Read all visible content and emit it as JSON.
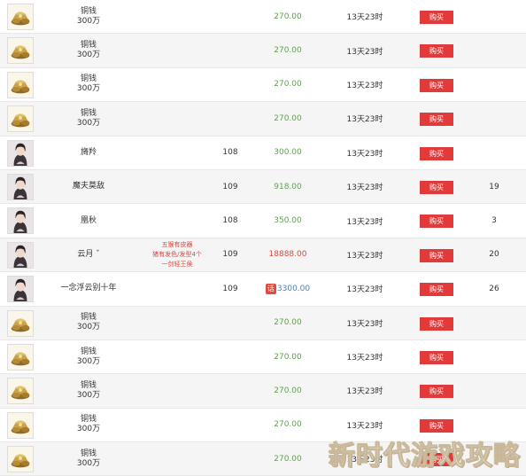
{
  "listings": [
    {
      "kind": "coin",
      "name1": "铜钱",
      "name2": "300万",
      "level": "",
      "price": "270.00",
      "price_style": "green",
      "time": "13天23时",
      "buy": "购买",
      "count": ""
    },
    {
      "kind": "coin",
      "name1": "铜钱",
      "name2": "300万",
      "level": "",
      "price": "270.00",
      "price_style": "green",
      "time": "13天23时",
      "buy": "购买",
      "count": ""
    },
    {
      "kind": "coin",
      "name1": "铜钱",
      "name2": "300万",
      "level": "",
      "price": "270.00",
      "price_style": "green",
      "time": "13天23时",
      "buy": "购买",
      "count": ""
    },
    {
      "kind": "coin",
      "name1": "铜钱",
      "name2": "300万",
      "level": "",
      "price": "270.00",
      "price_style": "green",
      "time": "13天23时",
      "buy": "购买",
      "count": ""
    },
    {
      "kind": "char",
      "name1": "旖羚",
      "name2": "",
      "level": "108",
      "price": "300.00",
      "price_style": "green",
      "time": "13天23时",
      "buy": "购买",
      "count": ""
    },
    {
      "kind": "char",
      "name1": "魔夫莫敌",
      "name2": "",
      "level": "109",
      "price": "918.00",
      "price_style": "green",
      "time": "13天23时",
      "buy": "购买",
      "count": "19"
    },
    {
      "kind": "char",
      "name1": "凰秋",
      "name2": "",
      "level": "108",
      "price": "350.00",
      "price_style": "green",
      "time": "13天23时",
      "buy": "购买",
      "count": "3"
    },
    {
      "kind": "char",
      "name1": "云月 ˇ",
      "name2": "",
      "level": "109",
      "price": "18888.00",
      "price_style": "red",
      "time": "13天23时",
      "buy": "购买",
      "count": "20",
      "desc": [
        "五猴有皮器",
        "猪有发色/发型4个",
        "一剑轻王侯"
      ]
    },
    {
      "kind": "char",
      "name1": "一念浮云别十年",
      "name2": "",
      "level": "109",
      "price": "3300.00",
      "price_style": "blue",
      "price_tag": "话",
      "time": "13天23时",
      "buy": "购买",
      "count": "26"
    },
    {
      "kind": "coin",
      "name1": "铜钱",
      "name2": "300万",
      "level": "",
      "price": "270.00",
      "price_style": "green",
      "time": "13天23时",
      "buy": "购买",
      "count": ""
    },
    {
      "kind": "coin",
      "name1": "铜钱",
      "name2": "300万",
      "level": "",
      "price": "270.00",
      "price_style": "green",
      "time": "13天23时",
      "buy": "购买",
      "count": ""
    },
    {
      "kind": "coin",
      "name1": "铜钱",
      "name2": "300万",
      "level": "",
      "price": "270.00",
      "price_style": "green",
      "time": "13天23时",
      "buy": "购买",
      "count": ""
    },
    {
      "kind": "coin",
      "name1": "铜钱",
      "name2": "300万",
      "level": "",
      "price": "270.00",
      "price_style": "green",
      "time": "13天23时",
      "buy": "购买",
      "count": ""
    },
    {
      "kind": "coin",
      "name1": "铜钱",
      "name2": "300万",
      "level": "",
      "price": "270.00",
      "price_style": "green",
      "time": "13天23时",
      "buy": "购买",
      "count": ""
    }
  ],
  "icons": {
    "coin": "gold-ingots-icon",
    "char": "character-portrait-icon"
  },
  "colors": {
    "buy_button": "#e03a3a",
    "price_green": "#5aa54a",
    "price_red": "#d9483b",
    "price_blue": "#4a7fc1",
    "description_red": "#d9483b"
  },
  "watermark": "新时代游戏攻略"
}
